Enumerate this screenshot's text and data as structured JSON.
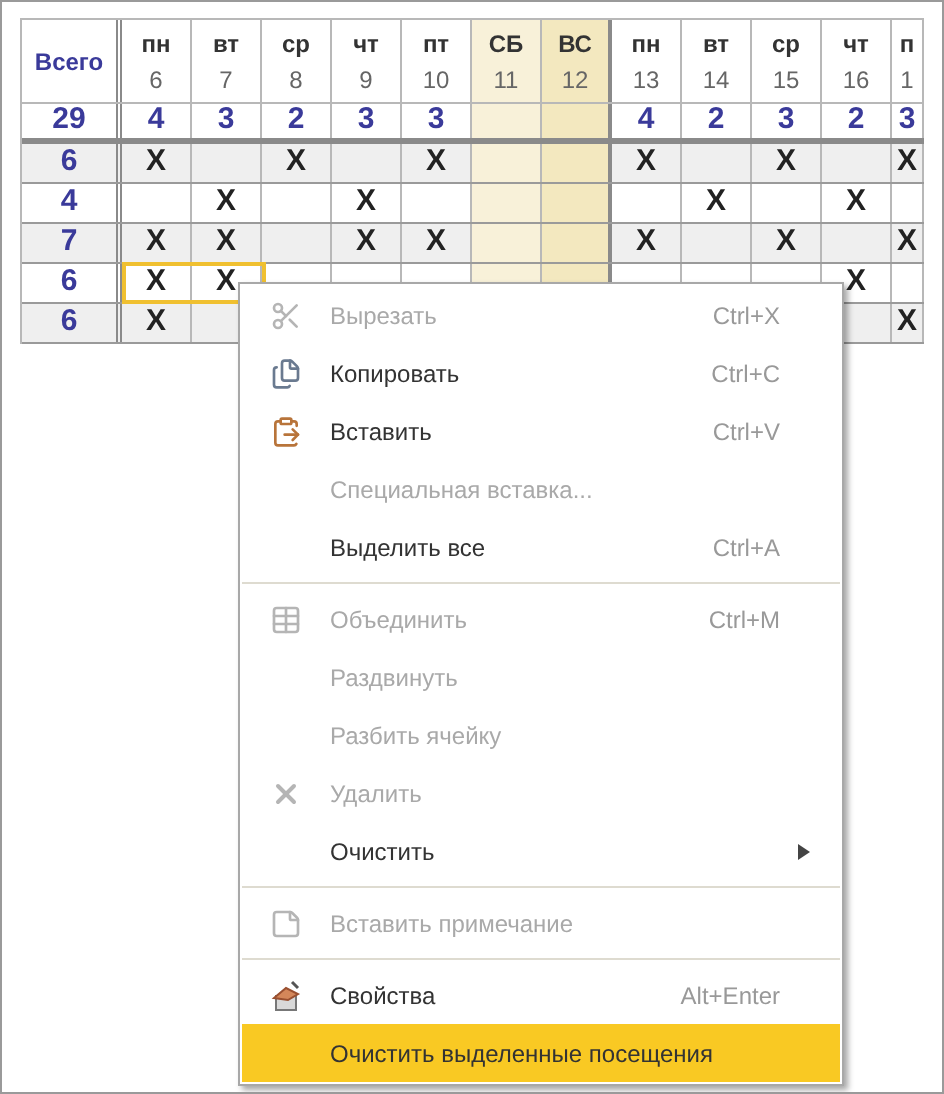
{
  "table": {
    "total_header": "Всего",
    "grand_total": "29",
    "columns": [
      {
        "day": "пн",
        "date": "6",
        "total": "4",
        "weekend": false
      },
      {
        "day": "вт",
        "date": "7",
        "total": "3",
        "weekend": false
      },
      {
        "day": "ср",
        "date": "8",
        "total": "2",
        "weekend": false
      },
      {
        "day": "чт",
        "date": "9",
        "total": "3",
        "weekend": false
      },
      {
        "day": "пт",
        "date": "10",
        "total": "3",
        "weekend": false
      },
      {
        "day": "СБ",
        "date": "11",
        "weekend": true,
        "color": "#f8f1d9"
      },
      {
        "day": "ВС",
        "date": "12",
        "weekend": true,
        "color": "#f3e8bf"
      },
      {
        "day": "пн",
        "date": "13",
        "total": "4",
        "weekend": false
      },
      {
        "day": "вт",
        "date": "14",
        "total": "2",
        "weekend": false
      },
      {
        "day": "ср",
        "date": "15",
        "total": "3",
        "weekend": false
      },
      {
        "day": "чт",
        "date": "16",
        "total": "2",
        "weekend": false
      },
      {
        "day": "п",
        "date": "1",
        "total": "3",
        "weekend": false
      }
    ],
    "rows": [
      {
        "total": "6",
        "cells": [
          "X",
          null,
          "X",
          null,
          "X",
          null,
          null,
          "X",
          null,
          "X",
          null,
          "X"
        ]
      },
      {
        "total": "4",
        "cells": [
          null,
          "X",
          null,
          "X",
          null,
          null,
          null,
          null,
          "X",
          null,
          "X",
          null
        ]
      },
      {
        "total": "7",
        "cells": [
          "X",
          "X",
          null,
          "X",
          "X",
          null,
          null,
          "X",
          null,
          "X",
          null,
          "X"
        ]
      },
      {
        "total": "6",
        "cells": [
          "X",
          "X",
          null,
          null,
          null,
          null,
          null,
          null,
          null,
          null,
          "X",
          null
        ],
        "selected_cells": true
      },
      {
        "total": "6",
        "cells": [
          "X",
          null,
          null,
          null,
          null,
          null,
          null,
          null,
          null,
          null,
          null,
          "X"
        ]
      }
    ]
  },
  "context_menu": {
    "items": [
      {
        "kind": "item",
        "text": "Вырезать",
        "shortcut": "Ctrl+X",
        "disabled": true,
        "selected": false
      },
      {
        "kind": "item",
        "text": "Копировать",
        "shortcut": "Ctrl+C",
        "disabled": false,
        "selected": false
      },
      {
        "kind": "item",
        "text": "Вставить",
        "shortcut": "Ctrl+V",
        "disabled": false,
        "selected": false
      },
      {
        "kind": "item",
        "text": "Специальная вставка...",
        "disabled": true,
        "selected": false
      },
      {
        "kind": "item",
        "text": "Выделить все",
        "shortcut": "Ctrl+A",
        "disabled": false,
        "selected": false
      },
      {
        "kind": "separator"
      },
      {
        "kind": "item",
        "text": "Объединить",
        "shortcut": "Ctrl+M",
        "disabled": true,
        "selected": false
      },
      {
        "kind": "item",
        "text": "Раздвинуть",
        "disabled": true,
        "selected": false
      },
      {
        "kind": "item",
        "text": "Разбить ячейку",
        "disabled": true,
        "selected": false
      },
      {
        "kind": "item",
        "text": "Удалить",
        "disabled": true,
        "selected": false
      },
      {
        "kind": "item",
        "text": "Очистить",
        "disabled": false,
        "submenu": true,
        "selected": false
      },
      {
        "kind": "separator"
      },
      {
        "kind": "item",
        "text": "Вставить примечание",
        "disabled": true,
        "selected": false
      },
      {
        "kind": "separator"
      },
      {
        "kind": "item",
        "text": "Свойства",
        "shortcut": "Alt+Enter",
        "disabled": false,
        "selected": false
      },
      {
        "kind": "item",
        "text": "Очистить выделенные посещения",
        "disabled": false,
        "selected": true
      }
    ]
  }
}
